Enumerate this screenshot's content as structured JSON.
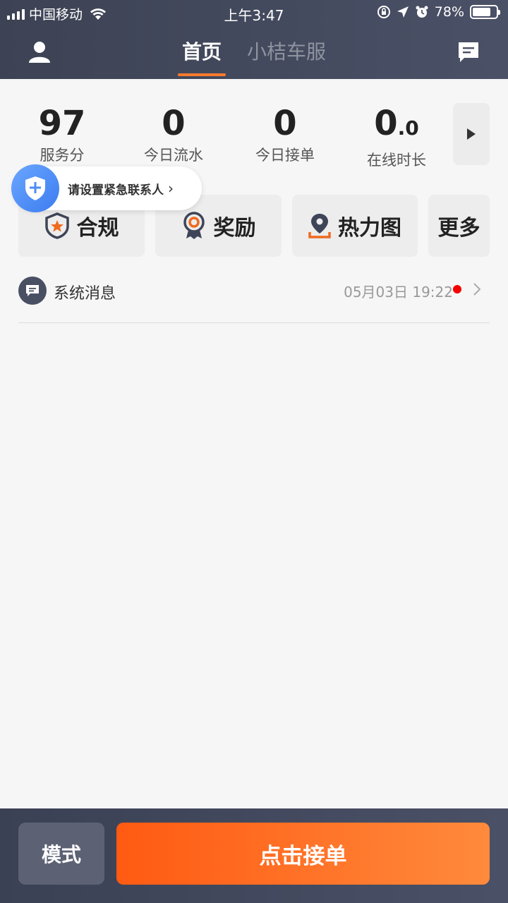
{
  "statusbar": {
    "carrier": "中国移动",
    "time": "上午3:47",
    "battery": "78%",
    "battery_level": 0.78
  },
  "header": {
    "tabs": [
      {
        "label": "首页",
        "active": true
      },
      {
        "label": "小桔车服",
        "active": false
      }
    ],
    "accent": "#ff7a2e"
  },
  "stats": {
    "service_score": {
      "value": "97",
      "label": "服务分"
    },
    "today_flow": {
      "value": "0",
      "label": "今日流水"
    },
    "today_orders": {
      "value": "0",
      "label": "今日接单"
    },
    "online_time": {
      "value": "0",
      "decimal": ".0",
      "label": "在线时长"
    }
  },
  "emergency": {
    "text": "请设置紧急联系人",
    "arrow": "›"
  },
  "quick_actions": [
    {
      "label": "合规",
      "icon": "compliance-shield-icon"
    },
    {
      "label": "奖励",
      "icon": "reward-medal-icon"
    },
    {
      "label": "热力图",
      "icon": "heatmap-pin-icon"
    },
    {
      "label": "更多",
      "icon": ""
    }
  ],
  "system_message": {
    "title": "系统消息",
    "time": "05月03日 19:22",
    "unread": true
  },
  "bottom": {
    "mode_label": "模式",
    "accept_label": "点击接单",
    "accept_color": "#ff6a1f"
  }
}
